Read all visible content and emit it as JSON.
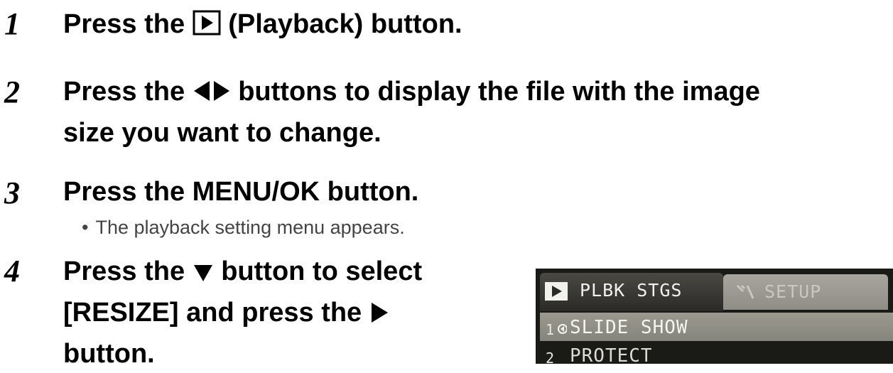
{
  "steps": [
    {
      "number": "1",
      "text_before_icon": "Press the",
      "text_after_icon": "(Playback) button.",
      "icon": "playback-icon"
    },
    {
      "number": "2",
      "text_before_icon": "Press the",
      "text_after_icon": "buttons to display the file with the image",
      "line2": "size you want to change.",
      "icon": "left-right-arrows-icon"
    },
    {
      "number": "3",
      "text": "Press the MENU/OK button.",
      "bullet": "The playback setting menu appears."
    },
    {
      "number": "4",
      "line1_before": "Press the",
      "line1_after": "button to select",
      "line2_before": "[RESIZE] and press the",
      "line3": "button.",
      "icon1": "down-arrow-icon",
      "icon2": "right-arrow-icon"
    }
  ],
  "lcd_menu": {
    "tab_playback_label": "PLBK STGS",
    "tab_setup_label": "SETUP",
    "page_number": "1",
    "items": [
      "SLIDE SHOW",
      "PROTECT"
    ],
    "colors": {
      "screen": "#1a1a16",
      "highlight": "#8f8d86",
      "text": "#f5f5f0"
    }
  }
}
